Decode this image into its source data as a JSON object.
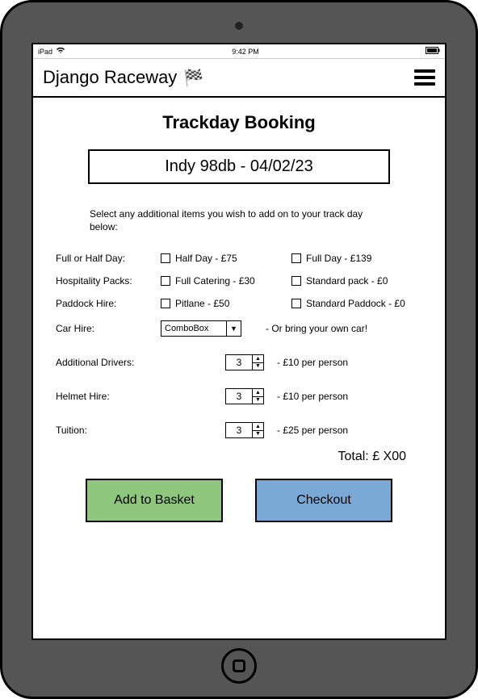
{
  "statusbar": {
    "carrier": "iPad",
    "time": "9:42 PM"
  },
  "header": {
    "brand": "Django Raceway",
    "flag_icon": "🏁"
  },
  "page": {
    "title": "Trackday Booking",
    "event": "Indy 98db - 04/02/23",
    "intro": "Select any additional items you wish to add on to your track day below:"
  },
  "form": {
    "day_label": "Full or Half Day:",
    "day_opts": {
      "half": "Half Day - £75",
      "full": "Full Day - £139"
    },
    "hospitality_label": "Hospitality Packs:",
    "hospitality_opts": {
      "catering": "Full Catering - £30",
      "standard": "Standard pack - £0"
    },
    "paddock_label": "Paddock Hire:",
    "paddock_opts": {
      "pitlane": "Pitlane - £50",
      "standard": "Standard Paddock - £0"
    },
    "carhire_label": "Car Hire:",
    "carhire_combo": "ComboBox",
    "carhire_note": "- Or bring your own car!",
    "drivers_label": "Additional Drivers:",
    "drivers_value": "3",
    "drivers_note": "- £10 per person",
    "helmet_label": "Helmet Hire:",
    "helmet_value": "3",
    "helmet_note": "- £10 per person",
    "tuition_label": "Tuition:",
    "tuition_value": "3",
    "tuition_note": "- £25 per person",
    "total": "Total: £ X00"
  },
  "buttons": {
    "add": "Add to Basket",
    "checkout": "Checkout"
  }
}
